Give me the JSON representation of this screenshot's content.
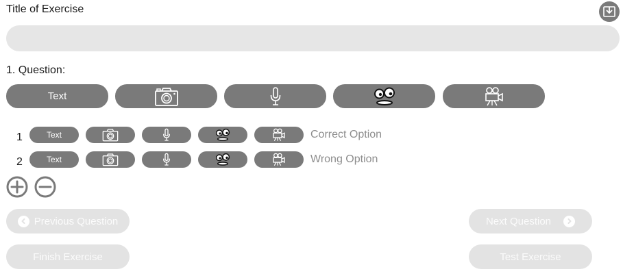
{
  "header": {
    "title_label": "Title of Exercise",
    "title_value": "",
    "download_icon": "download-icon"
  },
  "question": {
    "label": "1. Question:",
    "type_buttons": [
      {
        "label": "Text",
        "icon": "text"
      },
      {
        "label": "",
        "icon": "camera-icon"
      },
      {
        "label": "",
        "icon": "microphone-icon"
      },
      {
        "label": "",
        "icon": "face-icon"
      },
      {
        "label": "",
        "icon": "video-camera-icon"
      }
    ]
  },
  "options": [
    {
      "number": "1",
      "text_label": "Text",
      "option_text": "Correct Option"
    },
    {
      "number": "2",
      "text_label": "Text",
      "option_text": "Wrong Option"
    }
  ],
  "controls": {
    "add_icon": "plus-circle-icon",
    "remove_icon": "minus-circle-icon"
  },
  "navigation": {
    "previous": "Previous Question",
    "next": "Next Question",
    "finish": "Finish Exercise",
    "test": "Test Exercise"
  },
  "colors": {
    "button_dark": "#7a7a7a",
    "button_light": "#e3e3e3",
    "input_bg": "#e6e6e6",
    "option_text": "#8e8e8e"
  }
}
